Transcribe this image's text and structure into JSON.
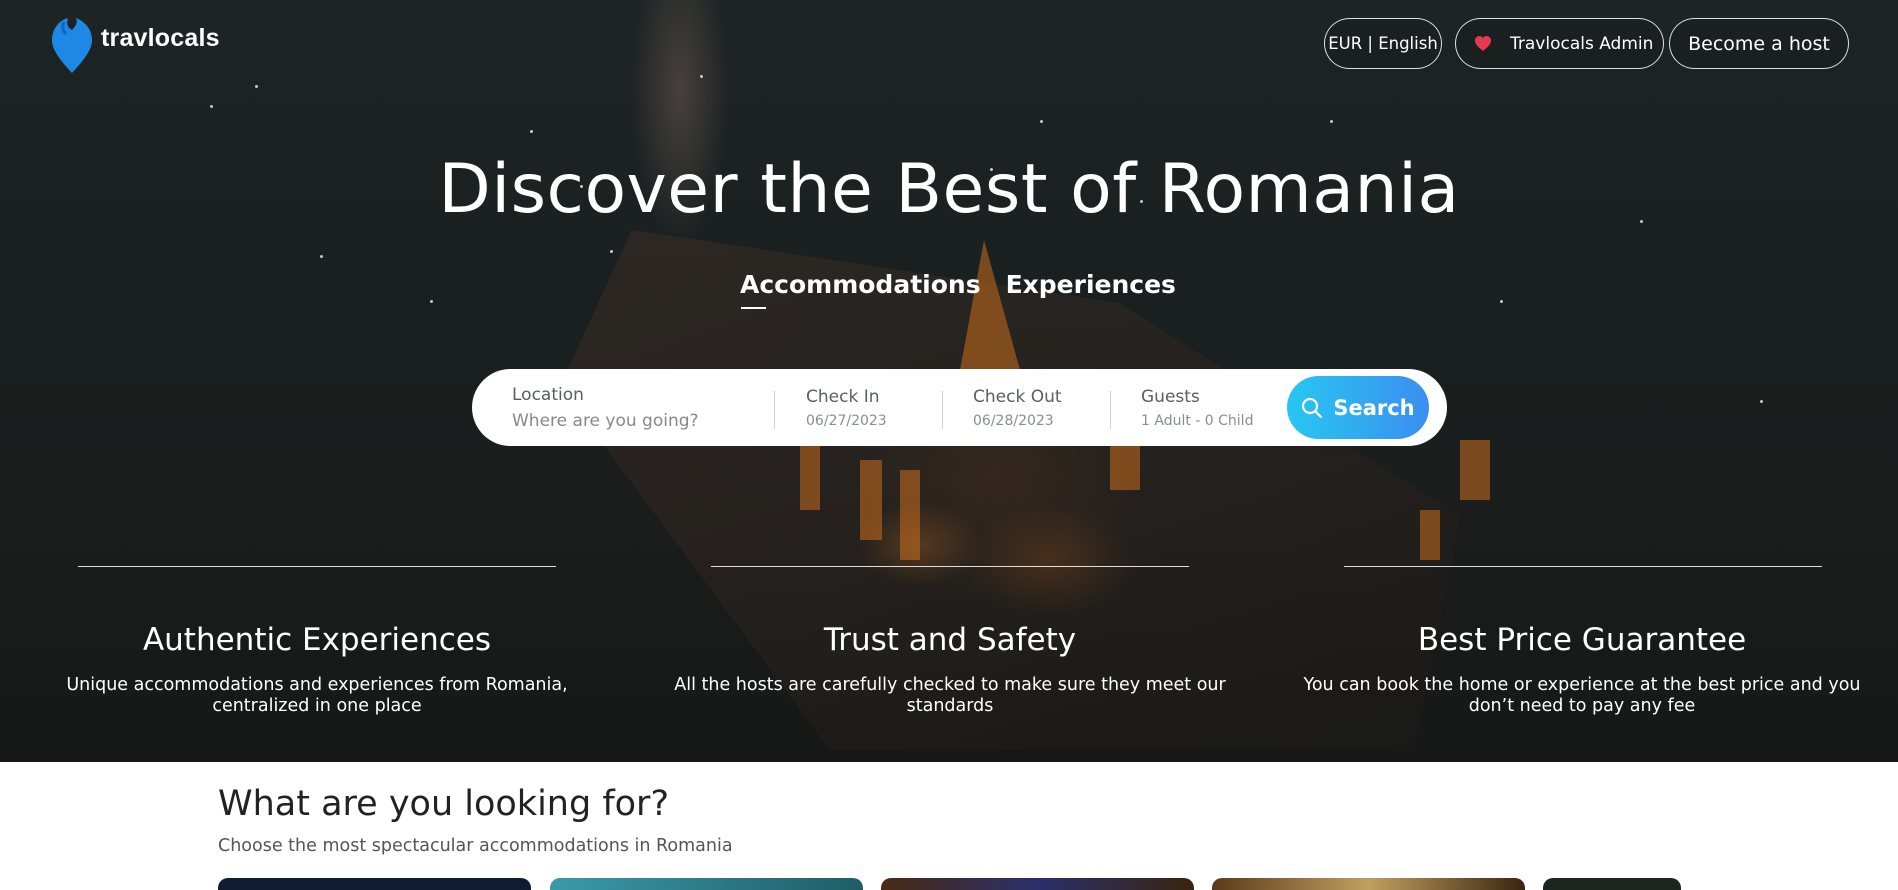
{
  "header": {
    "brand": "travlocals",
    "logo_icon": "drop-pin-icon",
    "currency_language": "EUR | English",
    "user_name": "Travlocals Admin",
    "user_icon": "heart-avatar-icon",
    "become_host": "Become a host"
  },
  "hero": {
    "title": "Discover the Best of Romania",
    "tabs": [
      {
        "label": "Accommodations",
        "active": true
      },
      {
        "label": "Experiences",
        "active": false
      }
    ]
  },
  "search": {
    "location_label": "Location",
    "location_placeholder": "Where are you going?",
    "checkin_label": "Check In",
    "checkin_value": "06/27/2023",
    "checkout_label": "Check Out",
    "checkout_value": "06/28/2023",
    "guests_label": "Guests",
    "guests_value": "1 Adult - 0 Child",
    "button_label": "Search",
    "button_icon": "search-icon"
  },
  "features": [
    {
      "title": "Authentic Experiences",
      "desc_line1": "Unique accommodations and experiences from Romania,",
      "desc_line2": "centralized in one place"
    },
    {
      "title": "Trust and Safety",
      "desc_line1": "All the hosts are carefully checked to make sure they meet our",
      "desc_line2": "standards"
    },
    {
      "title": "Best Price Guarantee",
      "desc_line1": "You can book the home or experience at the best price and you",
      "desc_line2": "don’t need to pay any fee"
    }
  ],
  "section": {
    "title": "What are you looking for?",
    "subtitle": "Choose the most spectacular accommodations in Romania"
  },
  "colors": {
    "accent_start": "#27c7f1",
    "accent_end": "#3b8ef0",
    "logo_blue": "#1e88e5",
    "heart_red": "#e53950"
  }
}
